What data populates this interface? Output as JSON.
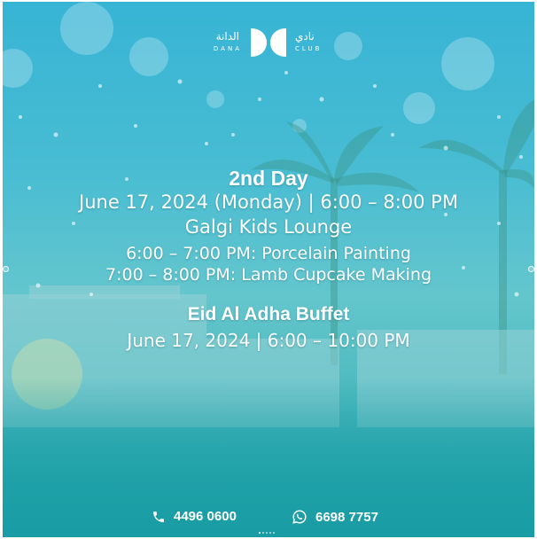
{
  "logo": {
    "arabic_left": "الدانة",
    "latin_left": "DANA",
    "arabic_right": "نادي",
    "latin_right": "CLUB"
  },
  "event": {
    "day_title": "2nd Day",
    "day_date": "June 17, 2024 (Monday) | 6:00 – 8:00 PM",
    "venue": "Galgi Kids Lounge",
    "activities": [
      "6:00 – 7:00 PM: Porcelain Painting",
      "7:00 – 8:00 PM: Lamb Cupcake Making"
    ]
  },
  "buffet": {
    "title": "Eid Al Adha Buffet",
    "date": "June 17, 2024 | 6:00 – 10:00 PM"
  },
  "contacts": {
    "phone": "4496 0600",
    "phone_icon": "phone-icon",
    "whatsapp": "6698 7757",
    "whatsapp_icon": "whatsapp-icon"
  },
  "colors": {
    "sky_top": "#37b4d4",
    "teal_bottom": "#1b9fa6",
    "text": "#ffffff"
  }
}
